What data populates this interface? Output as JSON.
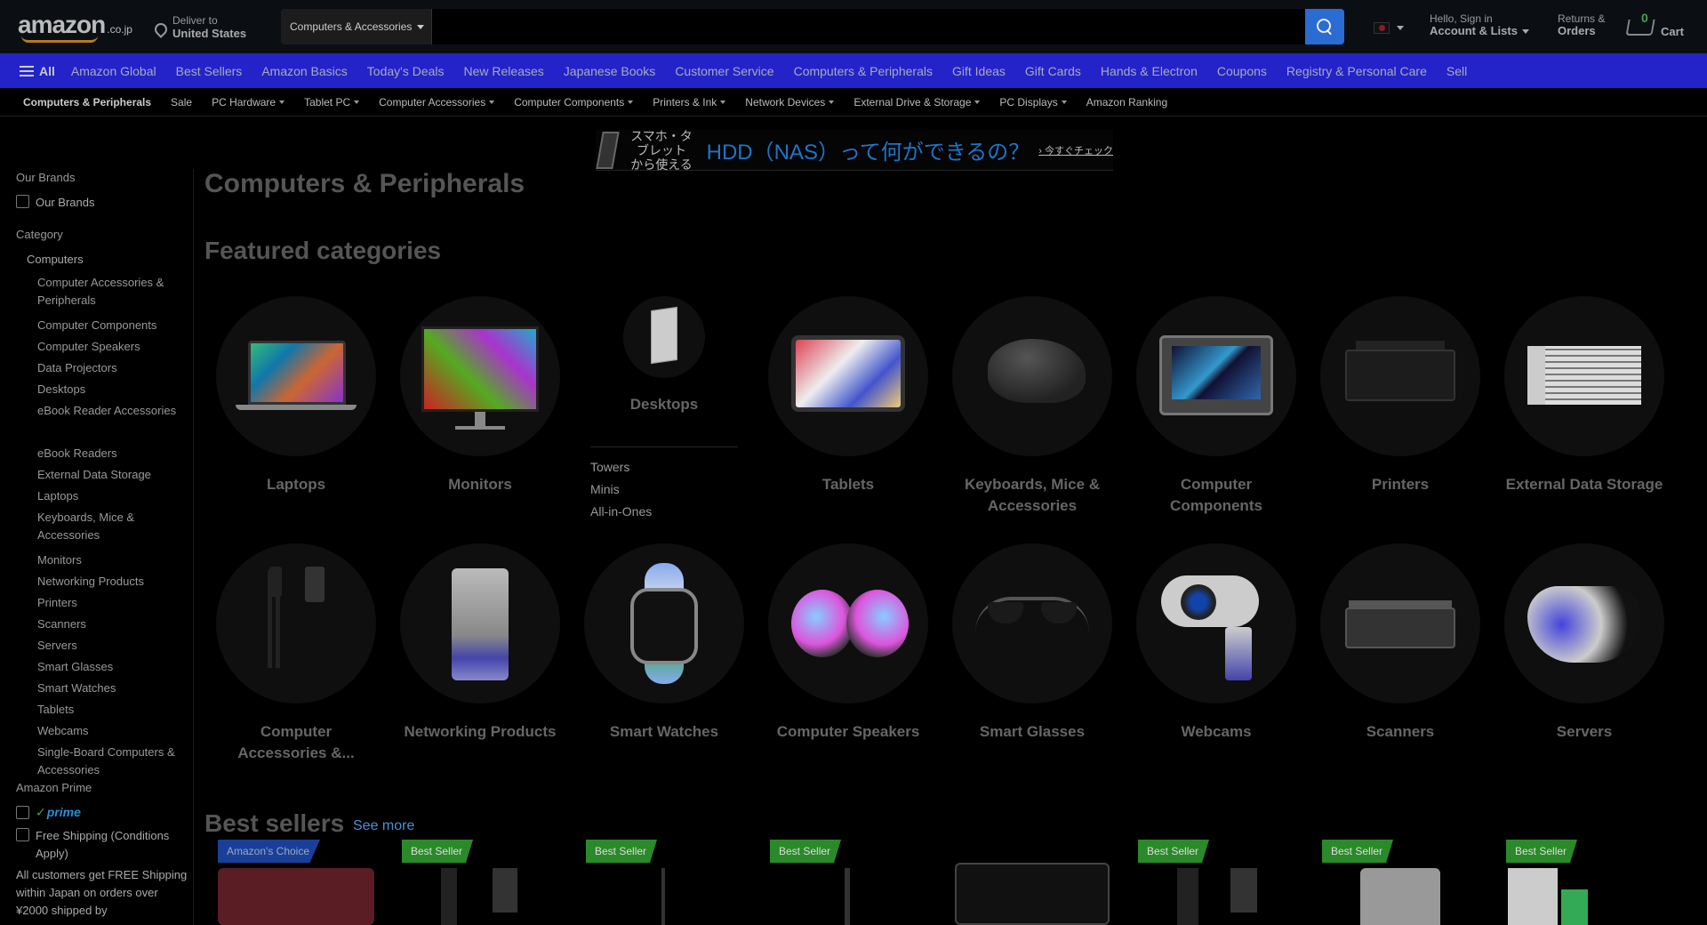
{
  "header": {
    "logo_text": "amazon",
    "logo_suffix": ".co.jp",
    "deliver_line1": "Deliver to",
    "deliver_line2": "United States",
    "search_dept": "Computers & Accessories",
    "search_placeholder": "",
    "account_line1": "Hello, Sign in",
    "account_line2": "Account & Lists",
    "returns_line1": "Returns &",
    "returns_line2": "Orders",
    "cart_count": "0",
    "cart_label": "Cart"
  },
  "main_nav": {
    "all_label": "All",
    "items": [
      "Amazon Global",
      "Best Sellers",
      "Amazon Basics",
      "Today's Deals",
      "New Releases",
      "Japanese Books",
      "Customer Service",
      "Computers & Peripherals",
      "Gift Ideas",
      "Gift Cards",
      "Hands & Electron",
      "Coupons",
      "Registry & Personal Care",
      "Sell"
    ]
  },
  "sub_nav": {
    "items": [
      {
        "label": "Computers & Peripherals",
        "dropdown": false
      },
      {
        "label": "Sale",
        "dropdown": false
      },
      {
        "label": "PC Hardware",
        "dropdown": true
      },
      {
        "label": "Tablet PC",
        "dropdown": true
      },
      {
        "label": "Computer Accessories",
        "dropdown": true
      },
      {
        "label": "Computer Components",
        "dropdown": true
      },
      {
        "label": "Printers & Ink",
        "dropdown": true
      },
      {
        "label": "Network Devices",
        "dropdown": true
      },
      {
        "label": "External Drive & Storage",
        "dropdown": true
      },
      {
        "label": "PC Displays",
        "dropdown": true
      },
      {
        "label": "Amazon Ranking",
        "dropdown": false
      }
    ]
  },
  "banner": {
    "line1": "スマホ・タブレット",
    "line2": "から使える",
    "headline": "HDD（NAS）って何ができるの？",
    "cta": "› 今すぐチェック"
  },
  "sidebar": {
    "our_brands_heading": "Our Brands",
    "our_brands_checkbox": "Our Brands",
    "category_heading": "Category",
    "category_parent": "Computers",
    "category_items": [
      "Computer Accessories & Peripherals",
      "Computer Components",
      "Computer Speakers",
      "Data Projectors",
      "Desktops",
      "eBook Reader Accessories",
      "eBook Readers",
      "External Data Storage",
      "Laptops",
      "Keyboards, Mice & Accessories",
      "Monitors",
      "Networking Products",
      "Printers",
      "Scanners",
      "Servers",
      "Smart Glasses",
      "Smart Watches",
      "Tablets",
      "Webcams",
      "Single-Board Computers & Accessories"
    ],
    "prime_heading": "Amazon Prime",
    "prime_label": "prime",
    "free_shipping_label": "Free Shipping (Conditions Apply)",
    "free_shipping_note": "All customers get FREE Shipping within Japan on orders over ¥2000 shipped by"
  },
  "main": {
    "page_title": "Computers & Peripherals",
    "featured_title": "Featured categories",
    "categories_row1": [
      "Laptops",
      "Monitors",
      "Desktops",
      "Tablets",
      "Keyboards, Mice & Accessories",
      "Computer Components",
      "Printers",
      "External Data Storage"
    ],
    "desktop_sublinks": [
      "Towers",
      "Minis",
      "All-in-Ones"
    ],
    "categories_row2": [
      "Computer Accessories &...",
      "Networking Products",
      "Smart Watches",
      "Computer Speakers",
      "Smart Glasses",
      "Webcams",
      "Scanners",
      "Servers"
    ],
    "best_sellers_title": "Best sellers",
    "see_more": "See more",
    "badges": [
      "Amazon's Choice",
      "Best Seller",
      "Best Seller",
      "Best Seller",
      "",
      "Best Seller",
      "Best Seller",
      "Best Seller"
    ]
  },
  "colors": {
    "nav_blue": "#2323c9",
    "search_button": "#2a6cd4",
    "badge_green": "#2a8a2a",
    "link_blue": "#4d8fd0"
  }
}
